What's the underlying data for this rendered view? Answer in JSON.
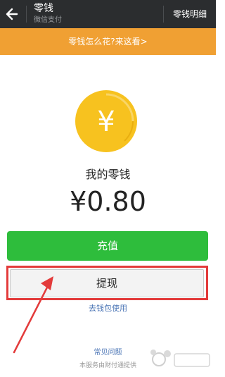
{
  "header": {
    "title": "零钱",
    "subtitle": "微信支付",
    "details_label": "零钱明细"
  },
  "banner": {
    "text": "零钱怎么花?来这看",
    "chevron": ">"
  },
  "coin": {
    "symbol": "¥"
  },
  "balance": {
    "label": "我的零钱",
    "value": "¥0.80"
  },
  "actions": {
    "recharge_label": "充值",
    "withdraw_label": "提现",
    "wallet_link": "去钱包使用"
  },
  "footer": {
    "faq": "常见问题",
    "provider_text": "本服务由财付通提供"
  },
  "colors": {
    "header_bg": "#2b2d2f",
    "banner_bg": "#f0a033",
    "coin_yellow": "#f7c21f",
    "recharge_green": "#2ebd3c",
    "highlight_red": "#e33b3b",
    "link_blue": "#4a74b5"
  },
  "icons": {
    "back": "arrow-left-icon",
    "coin": "yuan-coin-icon",
    "annotation": "red-arrow-icon"
  }
}
